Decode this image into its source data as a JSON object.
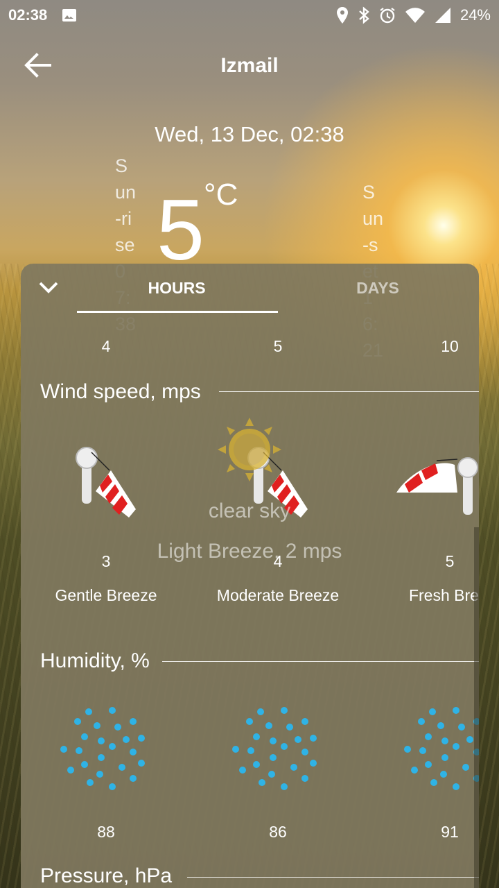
{
  "status_bar": {
    "time": "02:38",
    "battery": "24%",
    "icons": [
      "image-icon",
      "location-icon",
      "bluetooth-icon",
      "alarm-icon",
      "wifi-icon",
      "signal-icon"
    ]
  },
  "toolbar": {
    "city": "Izmail",
    "back_icon": "arrow-left-icon"
  },
  "current": {
    "datetime": "Wed, 13 Dec, 02:38",
    "temperature": "5",
    "unit": "°C",
    "sunrise": "Sun-rise 07:38",
    "sunset": "Sun-set 16:21",
    "description": "clear sky",
    "wind": "Light Breeze, 2 mps",
    "icon": "sun-icon"
  },
  "sheet": {
    "collapse_icon": "chevron-down-icon",
    "tabs": [
      {
        "label": "HOURS",
        "active": true
      },
      {
        "label": "DAYS",
        "active": false
      }
    ],
    "columns": [
      "4",
      "5",
      "10"
    ],
    "wind_section": {
      "title": "Wind speed, mps",
      "items": [
        {
          "value": "3",
          "name": "Gentle Breeze",
          "icon": "windsock-icon"
        },
        {
          "value": "4",
          "name": "Moderate Breeze",
          "icon": "windsock-icon"
        },
        {
          "value": "5",
          "name": "Fresh Breeze",
          "icon": "windsock-icon"
        }
      ]
    },
    "humidity_section": {
      "title": "Humidity, %",
      "items": [
        {
          "value": "88",
          "icon": "humidity-dots-icon"
        },
        {
          "value": "86",
          "icon": "humidity-dots-icon"
        },
        {
          "value": "91",
          "icon": "humidity-dots-icon"
        }
      ]
    },
    "pressure_section": {
      "title": "Pressure, hPa"
    }
  },
  "colors": {
    "accent": "#ffffff",
    "panel": "#807860",
    "humidity_dot": "#2fb3e6",
    "windsock_red": "#e02020"
  }
}
